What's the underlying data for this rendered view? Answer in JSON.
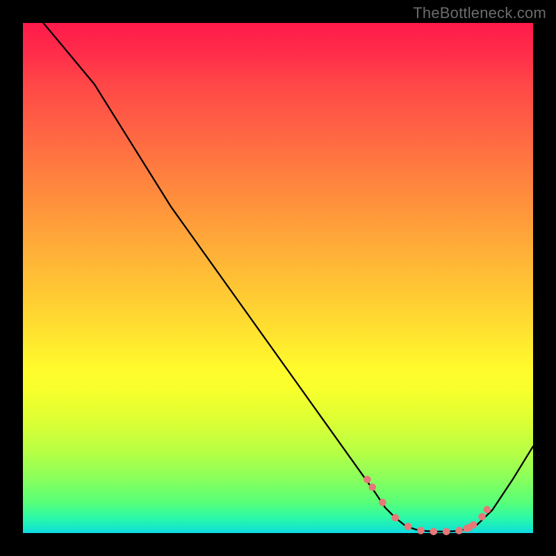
{
  "watermark": "TheBottleneck.com",
  "chart_data": {
    "type": "line",
    "title": "",
    "xlabel": "",
    "ylabel": "",
    "xlim": [
      0,
      100
    ],
    "ylim": [
      0,
      100
    ],
    "series": [
      {
        "name": "curve",
        "x": [
          4,
          9,
          14,
          19,
          24,
          29,
          34,
          39,
          44,
          49,
          54,
          59,
          64,
          69,
          71,
          73,
          75,
          77,
          79,
          81,
          83,
          85,
          87,
          89,
          92,
          96,
          100
        ],
        "y": [
          100,
          94,
          88,
          80,
          72,
          64,
          57,
          50,
          43,
          36,
          29,
          22,
          15,
          8,
          5,
          3,
          1.4,
          0.7,
          0.4,
          0.3,
          0.3,
          0.4,
          0.8,
          1.6,
          4.5,
          10.5,
          17
        ]
      }
    ],
    "highlight": {
      "name": "highlight-dots",
      "color": "#e77878",
      "x": [
        67.5,
        68.5,
        70.5,
        73,
        75.5,
        78,
        80.5,
        83,
        85.5,
        87,
        87.5,
        88.3,
        90,
        91
      ],
      "y": [
        10.5,
        9,
        6,
        3,
        1.3,
        0.5,
        0.3,
        0.3,
        0.5,
        0.9,
        1.1,
        1.6,
        3.2,
        4.6
      ]
    },
    "background": "rainbow-vertical"
  }
}
